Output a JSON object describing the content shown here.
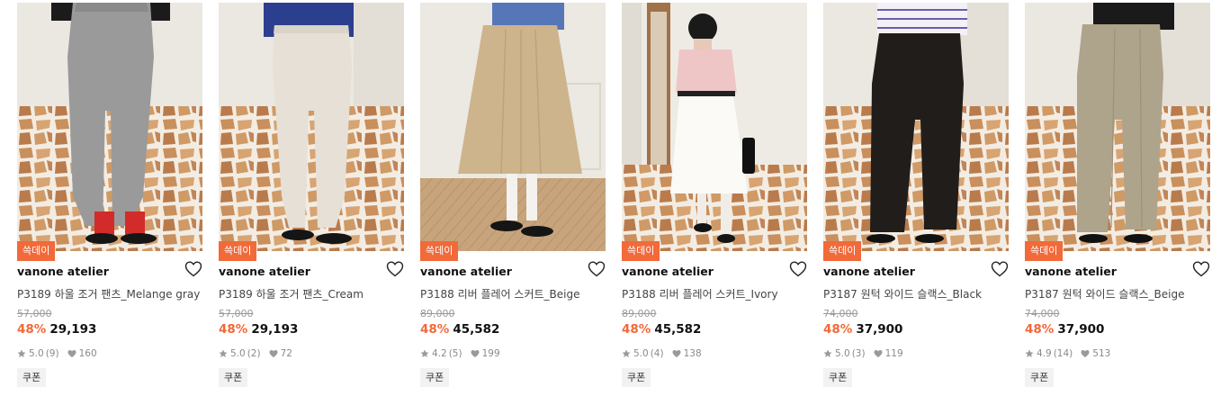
{
  "products": [
    {
      "badge": "쓱데이",
      "brand": "vanone atelier",
      "name": "P3189 하울 조거 팬츠_Melange gray",
      "original_price": "57,000",
      "discount": "48%",
      "price": "29,193",
      "rating": "5.0",
      "review_count": "(9)",
      "likes": "160",
      "coupon": "쿠폰",
      "image_icon": "product-photo-gray-joggers"
    },
    {
      "badge": "쓱데이",
      "brand": "vanone atelier",
      "name": "P3189 하울 조거 팬츠_Cream",
      "original_price": "57,000",
      "discount": "48%",
      "price": "29,193",
      "rating": "5.0",
      "review_count": "(2)",
      "likes": "72",
      "coupon": "쿠폰",
      "image_icon": "product-photo-cream-joggers"
    },
    {
      "badge": "쓱데이",
      "brand": "vanone atelier",
      "name": "P3188 리버 플레어 스커트_Beige",
      "original_price": "89,000",
      "discount": "48%",
      "price": "45,582",
      "rating": "4.2",
      "review_count": "(5)",
      "likes": "199",
      "coupon": "쿠폰",
      "image_icon": "product-photo-beige-skirt"
    },
    {
      "badge": "쓱데이",
      "brand": "vanone atelier",
      "name": "P3188 리버 플레어 스커트_Ivory",
      "original_price": "89,000",
      "discount": "48%",
      "price": "45,582",
      "rating": "5.0",
      "review_count": "(4)",
      "likes": "138",
      "coupon": "쿠폰",
      "image_icon": "product-photo-ivory-skirt"
    },
    {
      "badge": "쓱데이",
      "brand": "vanone atelier",
      "name": "P3187 원턱 와이드 슬랙스_Black",
      "original_price": "74,000",
      "discount": "48%",
      "price": "37,900",
      "rating": "5.0",
      "review_count": "(3)",
      "likes": "119",
      "coupon": "쿠폰",
      "image_icon": "product-photo-black-slacks"
    },
    {
      "badge": "쓱데이",
      "brand": "vanone atelier",
      "name": "P3187 원턱 와이드 슬랙스_Beige",
      "original_price": "74,000",
      "discount": "48%",
      "price": "37,900",
      "rating": "4.9",
      "review_count": "(14)",
      "likes": "513",
      "coupon": "쿠폰",
      "image_icon": "product-photo-beige-slacks"
    }
  ],
  "colors": {
    "accent": "#f2693a",
    "muted": "#8a8a8a"
  }
}
